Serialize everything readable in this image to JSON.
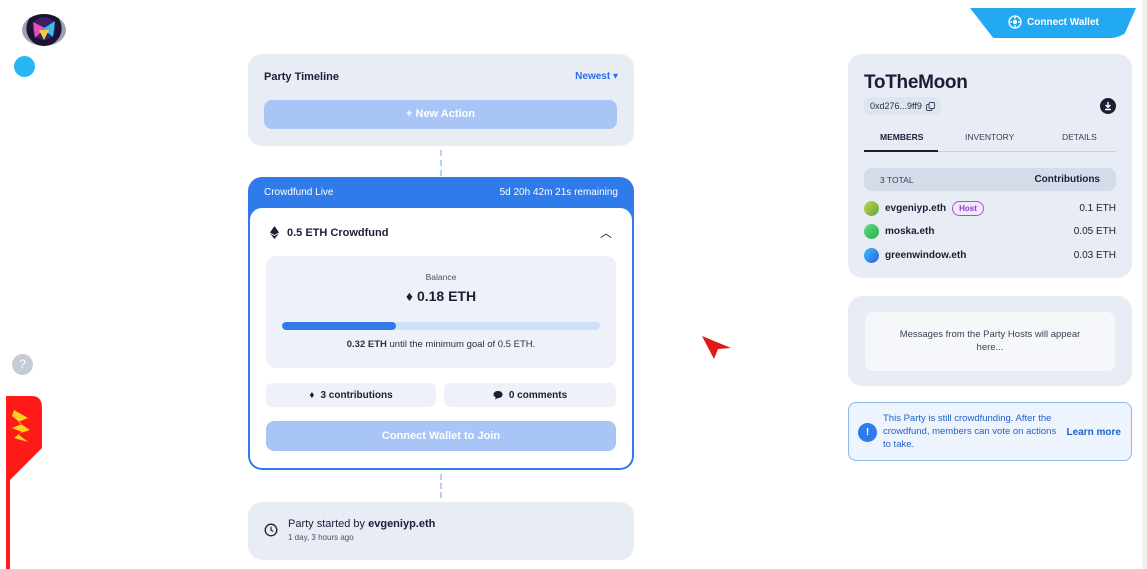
{
  "header": {
    "connect_wallet_label": "Connect Wallet"
  },
  "sidebar": {
    "help_label": "?"
  },
  "timeline": {
    "title": "Party Timeline",
    "sort_label": "Newest",
    "new_action_label": "+ New Action"
  },
  "crowdfund": {
    "status_label": "Crowdfund Live",
    "time_remaining": "5d 20h 42m 21s remaining",
    "title": "0.5 ETH Crowdfund",
    "balance_label": "Balance",
    "balance_value": "0.18 ETH",
    "progress_fraction": 0.36,
    "remaining_amount": "0.32 ETH",
    "remaining_text": "until the minimum goal of 0.5 ETH.",
    "contributions_label": "3 contributions",
    "comments_label": "0 comments",
    "join_label": "Connect Wallet to Join"
  },
  "started": {
    "prefix": "Party started by",
    "user": "evgeniyp.eth",
    "time": "1 day, 3 hours ago"
  },
  "party": {
    "name": "ToTheMoon",
    "address": "0xd276...9ff9",
    "tabs": [
      "MEMBERS",
      "INVENTORY",
      "DETAILS"
    ],
    "members_total": "3 TOTAL",
    "contributions_header": "Contributions",
    "members": [
      {
        "name": "evgeniyp.eth",
        "badge": "Host",
        "amount": "0.1 ETH",
        "color": "#8bc34a"
      },
      {
        "name": "moska.eth",
        "badge": "",
        "amount": "0.05 ETH",
        "color": "#43c465"
      },
      {
        "name": "greenwindow.eth",
        "badge": "",
        "amount": "0.03 ETH",
        "color": "#2c8cf0"
      }
    ]
  },
  "messages": {
    "placeholder": "Messages from the Party Hosts will appear here..."
  },
  "info": {
    "icon_label": "!",
    "text": "This Party is still crowdfunding. After the crowdfund, members can vote on actions to take.",
    "learn_more": "Learn more"
  },
  "colors": {
    "accent": "#2f7bea",
    "connect_tab": "#23a8f2",
    "host_badge": "#8a3fc7"
  }
}
